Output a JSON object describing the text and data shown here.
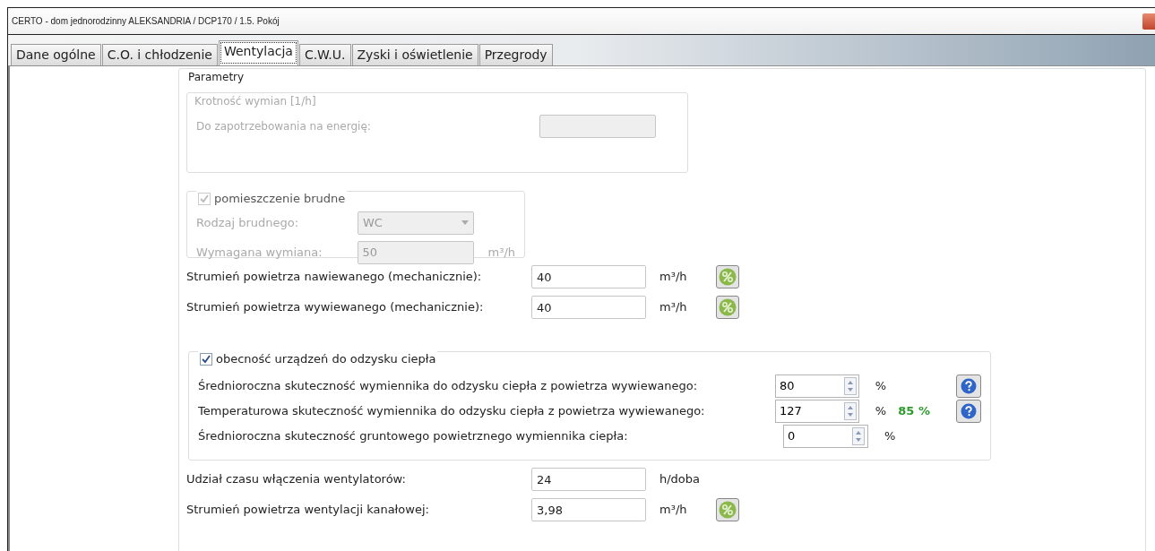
{
  "window": {
    "title": "CERTO - dom jednorodzinny ALEKSANDRIA / DCP170 / 1.5. Pokój"
  },
  "tabs": [
    {
      "label": "Dane ogólne",
      "selected": false
    },
    {
      "label": "C.O. i chłodzenie",
      "selected": false
    },
    {
      "label": "Wentylacja",
      "selected": true
    },
    {
      "label": "C.W.U.",
      "selected": false
    },
    {
      "label": "Zyski i oświetlenie",
      "selected": false
    },
    {
      "label": "Przegrody",
      "selected": false
    }
  ],
  "parameters": {
    "title": "Parametry",
    "exchange_rate": {
      "title": "Krotność wymian [1/h]",
      "disabled": true,
      "label": "Do zapotrzebowania na energię:"
    },
    "dirty_room": {
      "label": "pomieszczenie brudne",
      "checked": true,
      "disabled": true,
      "type_label": "Rodzaj brudnego:",
      "type_value": "WC",
      "required_label": "Wymagana wymiana:",
      "required_value": "50",
      "required_unit": "m³/h"
    },
    "flows": [
      {
        "label": "Strumień powietrza nawiewanego (mechanicznie):",
        "value": "40",
        "unit": "m³/h",
        "percent_button": true
      },
      {
        "label": "Strumień powietrza wywiewanego (mechanicznie):",
        "value": "40",
        "unit": "m³/h",
        "percent_button": true
      }
    ],
    "heat_recovery": {
      "label": "obecność urządzeń do odzysku ciepła",
      "checked": true,
      "rows": [
        {
          "label": "Średnioroczna skuteczność wymiennika do odzysku ciepła z powietrza wywiewanego:",
          "value": "80",
          "unit": "%",
          "help_button": true
        },
        {
          "label": "Temperaturowa skuteczność wymiennika do odzysku ciepła z powietrza wywiewanego:",
          "value": "127",
          "unit": "%",
          "result": "85 %",
          "help_button": true
        },
        {
          "label": "Średnioroczna skuteczność gruntowego powietrznego wymiennika ciepła:",
          "value": "0",
          "unit": "%",
          "help_button": false
        }
      ]
    },
    "extra": [
      {
        "label": "Udział czasu włączenia wentylatorów:",
        "value": "24",
        "unit": "h/doba",
        "percent_button": false
      },
      {
        "label": "Strumień powietrza wentylacji kanałowej:",
        "value": "3,98",
        "unit": "m³/h",
        "percent_button": true
      }
    ]
  }
}
